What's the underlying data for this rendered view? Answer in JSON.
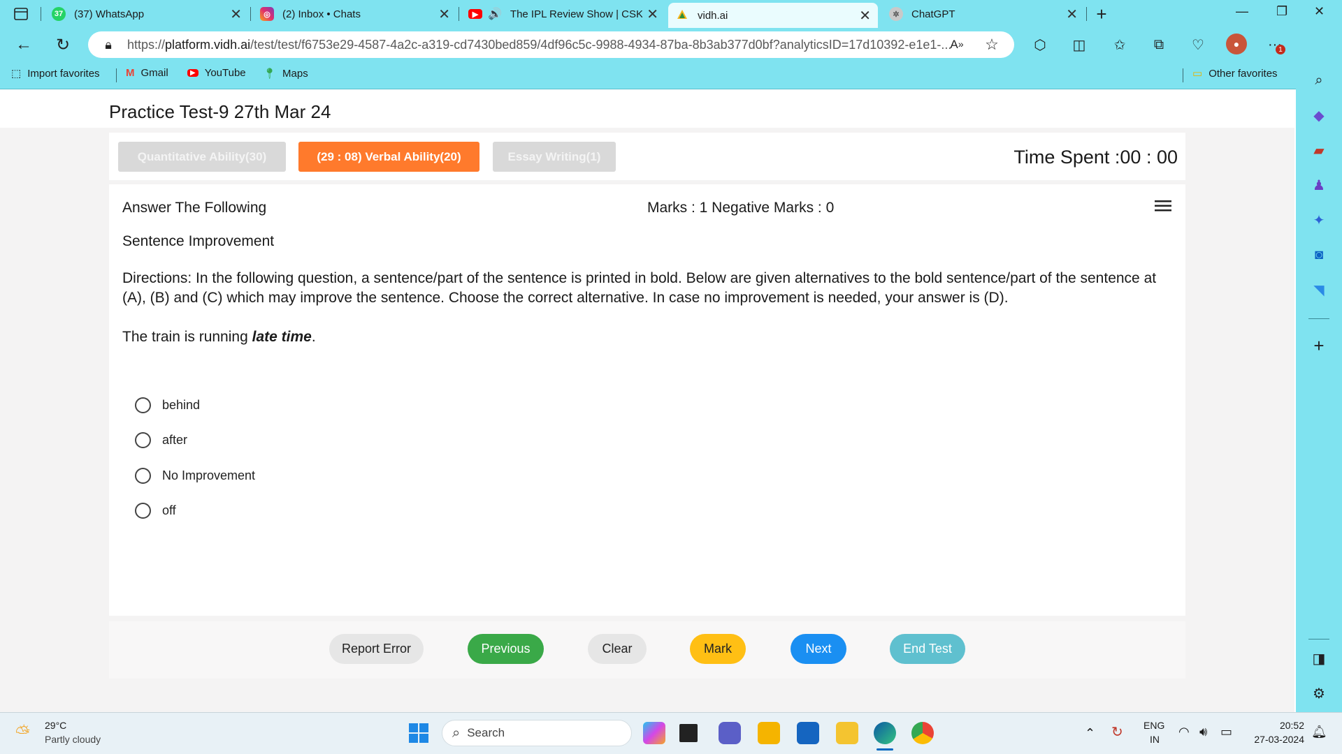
{
  "browser": {
    "tabs": [
      {
        "title": "(37) WhatsApp",
        "icon": "whatsapp-icon"
      },
      {
        "title": "(2) Inbox • Chats",
        "icon": "instagram-icon"
      },
      {
        "title": "The IPL Review Show | CSK v",
        "icon": "youtube-icon"
      },
      {
        "title": "vidh.ai",
        "icon": "vidhai-icon"
      },
      {
        "title": "ChatGPT",
        "icon": "chatgpt-icon"
      }
    ],
    "url_prefix": "https://",
    "url_host": "platform.vidh.ai",
    "url_path": "/test/test/f6753e29-4587-4a2c-a319-cd7430bed859/4df96c5c-9988-4934-87ba-8b3ab377d0bf?analyticsID=17d10392-e1e1-...",
    "favorites": [
      "Import favorites",
      "Gmail",
      "YouTube",
      "Maps"
    ],
    "other_favorites": "Other favorites",
    "notification_count": "1"
  },
  "test": {
    "title": "Practice Test-9 27th Mar 24",
    "sections": [
      "Quantitative Ability(30)",
      "(29 : 08) Verbal Ability(20)",
      "Essay Writing(1)"
    ],
    "time_spent": "Time Spent :00 : 00",
    "heading": "Answer The Following",
    "marks": "Marks : 1  Negative Marks : 0",
    "topic": "Sentence Improvement",
    "directions": "Directions: In the following question, a sentence/part of the sentence is printed in bold. Below are given alternatives to the bold sentence/part of the sentence at (A), (B) and (C) which may improve the sentence. Choose the correct alternative. In case no improvement is needed, your answer is (D).",
    "question_prefix": "The train is running ",
    "question_bold": "late time",
    "question_suffix": ".",
    "options": [
      "behind",
      "after",
      "No Improvement",
      "off"
    ],
    "buttons": {
      "report": "Report Error",
      "previous": "Previous",
      "clear": "Clear",
      "mark": "Mark",
      "next": "Next",
      "end": "End Test"
    }
  },
  "taskbar": {
    "temp": "29°C",
    "weather": "Partly cloudy",
    "search_placeholder": "Search",
    "lang1": "ENG",
    "lang2": "IN",
    "time": "20:52",
    "date": "27-03-2024"
  },
  "colors": {
    "browser_chrome": "#7fe3f0",
    "active_section": "#ff7a2c",
    "previous": "#3aa948",
    "mark": "#ffbf14",
    "next": "#1a8ff2",
    "end": "#5fc0cf"
  }
}
